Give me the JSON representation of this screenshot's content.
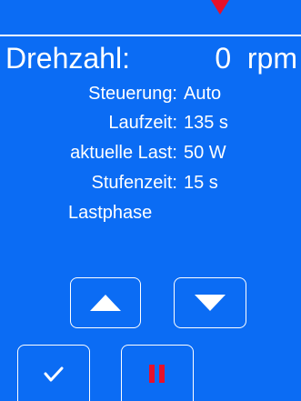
{
  "speed": {
    "label": "Drehzahl:",
    "value": "0",
    "unit": "rpm"
  },
  "status": [
    {
      "key": "Steuerung:",
      "value": "Auto"
    },
    {
      "key": "Laufzeit:",
      "value": "135 s"
    },
    {
      "key": "aktuelle Last:",
      "value": "50 W"
    },
    {
      "key": "Stufenzeit:",
      "value": "15 s"
    }
  ],
  "phase": "Lastphase",
  "icons": {
    "marker": "down-triangle-marker-icon",
    "up": "up-arrow-icon",
    "down": "down-arrow-icon",
    "confirm": "checkmark-icon",
    "pause": "pause-icon"
  },
  "colors": {
    "background": "#0b6cf4",
    "marker": "#e8102a",
    "pause": "#e8102a",
    "text": "#ffffff"
  }
}
